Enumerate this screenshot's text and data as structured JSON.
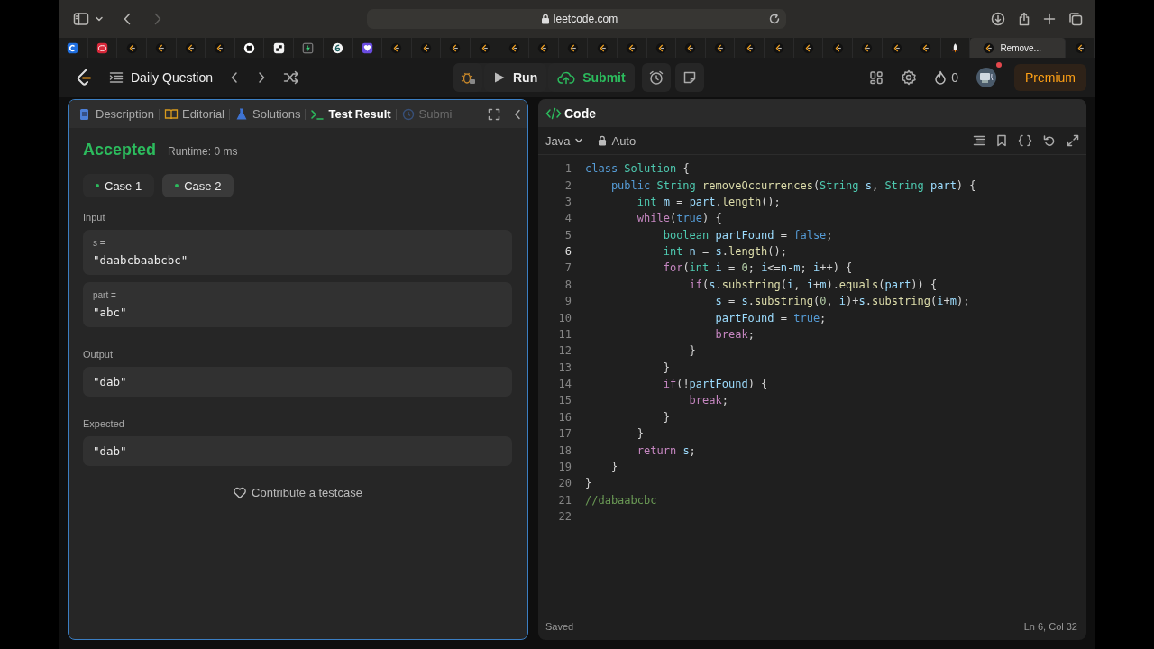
{
  "browser": {
    "url": "leetcode.com",
    "tabs": [
      {
        "kind": "c",
        "selected": false
      },
      {
        "kind": "fup",
        "selected": false
      },
      {
        "kind": "lc",
        "selected": false
      },
      {
        "kind": "lc",
        "selected": false
      },
      {
        "kind": "lc",
        "selected": false
      },
      {
        "kind": "lc",
        "selected": false
      },
      {
        "kind": "github",
        "selected": false
      },
      {
        "kind": "square",
        "selected": false
      },
      {
        "kind": "bolt",
        "selected": false
      },
      {
        "kind": "six",
        "selected": false
      },
      {
        "kind": "heart",
        "selected": false
      },
      {
        "kind": "lc",
        "selected": false
      },
      {
        "kind": "lc",
        "selected": false
      },
      {
        "kind": "lc",
        "selected": false
      },
      {
        "kind": "lc",
        "selected": false
      },
      {
        "kind": "lc",
        "selected": false
      },
      {
        "kind": "lc",
        "selected": false
      },
      {
        "kind": "lc",
        "selected": false
      },
      {
        "kind": "lc",
        "selected": false
      },
      {
        "kind": "lc",
        "selected": false
      },
      {
        "kind": "lc",
        "selected": false
      },
      {
        "kind": "lc",
        "selected": false
      },
      {
        "kind": "lc",
        "selected": false
      },
      {
        "kind": "lc",
        "selected": false
      },
      {
        "kind": "lc",
        "selected": false
      },
      {
        "kind": "lc",
        "selected": false
      },
      {
        "kind": "lc",
        "selected": false
      },
      {
        "kind": "lc",
        "selected": false
      },
      {
        "kind": "lc",
        "selected": false
      },
      {
        "kind": "lc",
        "selected": false
      },
      {
        "kind": "rocket",
        "selected": false
      },
      {
        "kind": "lc",
        "label": "Remove...",
        "selected": true
      },
      {
        "kind": "lc",
        "selected": false
      }
    ]
  },
  "navbar": {
    "title": "Daily Question",
    "run": "Run",
    "submit": "Submit",
    "streak": "0",
    "premium": "Premium"
  },
  "left_panel": {
    "tabs": [
      {
        "kind": "description",
        "label": "Description",
        "selected": false
      },
      {
        "kind": "editorial",
        "label": "Editorial",
        "selected": false
      },
      {
        "kind": "solutions",
        "label": "Solutions",
        "selected": false
      },
      {
        "kind": "test",
        "label": "Test Result",
        "selected": true
      },
      {
        "kind": "submissions",
        "label": "Submi",
        "selected": false
      }
    ],
    "status": "Accepted",
    "runtime": "Runtime: 0 ms",
    "cases": [
      {
        "label": "Case 1",
        "selected": false
      },
      {
        "label": "Case 2",
        "selected": true
      }
    ],
    "input_label": "Input",
    "inputs": [
      {
        "name": "s =",
        "value": "\"daabcbaabcbc\""
      },
      {
        "name": "part =",
        "value": "\"abc\""
      }
    ],
    "output_label": "Output",
    "output": "\"dab\"",
    "expected_label": "Expected",
    "expected": "\"dab\"",
    "contribute": "Contribute a testcase"
  },
  "code_panel": {
    "title": "Code",
    "language": "Java",
    "mode": "Auto",
    "lines": [
      {
        "number": "1",
        "current": false,
        "tokens": [
          {
            "kind": "keyword",
            "text": "class"
          },
          {
            "kind": "type",
            "text": " Solution"
          },
          {
            "kind": "plain",
            "text": " {"
          }
        ]
      },
      {
        "number": "2",
        "current": false,
        "tokens": [
          {
            "kind": "keyword",
            "text": "    public"
          },
          {
            "kind": "type",
            "text": " String"
          },
          {
            "kind": "function",
            "text": " removeOccurrences"
          },
          {
            "kind": "plain",
            "text": "("
          },
          {
            "kind": "type",
            "text": "String"
          },
          {
            "kind": "variable",
            "text": " s"
          },
          {
            "kind": "plain",
            "text": ", "
          },
          {
            "kind": "type",
            "text": "String"
          },
          {
            "kind": "variable",
            "text": " part"
          },
          {
            "kind": "plain",
            "text": ") {"
          }
        ]
      },
      {
        "number": "3",
        "current": false,
        "tokens": [
          {
            "kind": "type",
            "text": "        int"
          },
          {
            "kind": "variable",
            "text": " m"
          },
          {
            "kind": "plain",
            "text": " = "
          },
          {
            "kind": "variable",
            "text": "part"
          },
          {
            "kind": "plain",
            "text": "."
          },
          {
            "kind": "function",
            "text": "length"
          },
          {
            "kind": "plain",
            "text": "();"
          }
        ]
      },
      {
        "number": "4",
        "current": false,
        "tokens": [
          {
            "kind": "control",
            "text": "        while"
          },
          {
            "kind": "plain",
            "text": "("
          },
          {
            "kind": "keyword",
            "text": "true"
          },
          {
            "kind": "plain",
            "text": ") {"
          }
        ]
      },
      {
        "number": "5",
        "current": false,
        "tokens": [
          {
            "kind": "type",
            "text": "            boolean"
          },
          {
            "kind": "variable",
            "text": " partFound"
          },
          {
            "kind": "plain",
            "text": " = "
          },
          {
            "kind": "keyword",
            "text": "false"
          },
          {
            "kind": "plain",
            "text": ";"
          }
        ]
      },
      {
        "number": "6",
        "current": true,
        "tokens": [
          {
            "kind": "type",
            "text": "            int"
          },
          {
            "kind": "variable",
            "text": " n"
          },
          {
            "kind": "plain",
            "text": " = "
          },
          {
            "kind": "variable",
            "text": "s"
          },
          {
            "kind": "plain",
            "text": "."
          },
          {
            "kind": "function",
            "text": "length"
          },
          {
            "kind": "plain",
            "text": "();"
          }
        ]
      },
      {
        "number": "7",
        "current": false,
        "tokens": [
          {
            "kind": "control",
            "text": "            for"
          },
          {
            "kind": "plain",
            "text": "("
          },
          {
            "kind": "type",
            "text": "int"
          },
          {
            "kind": "variable",
            "text": " i"
          },
          {
            "kind": "plain",
            "text": " = "
          },
          {
            "kind": "number",
            "text": "0"
          },
          {
            "kind": "plain",
            "text": "; "
          },
          {
            "kind": "variable",
            "text": "i"
          },
          {
            "kind": "plain",
            "text": "<="
          },
          {
            "kind": "variable",
            "text": "n"
          },
          {
            "kind": "plain",
            "text": "-"
          },
          {
            "kind": "variable",
            "text": "m"
          },
          {
            "kind": "plain",
            "text": "; "
          },
          {
            "kind": "variable",
            "text": "i"
          },
          {
            "kind": "plain",
            "text": "++) {"
          }
        ]
      },
      {
        "number": "8",
        "current": false,
        "tokens": [
          {
            "kind": "control",
            "text": "                if"
          },
          {
            "kind": "plain",
            "text": "("
          },
          {
            "kind": "variable",
            "text": "s"
          },
          {
            "kind": "plain",
            "text": "."
          },
          {
            "kind": "function",
            "text": "substring"
          },
          {
            "kind": "plain",
            "text": "("
          },
          {
            "kind": "variable",
            "text": "i"
          },
          {
            "kind": "plain",
            "text": ", "
          },
          {
            "kind": "variable",
            "text": "i"
          },
          {
            "kind": "plain",
            "text": "+"
          },
          {
            "kind": "variable",
            "text": "m"
          },
          {
            "kind": "plain",
            "text": ")."
          },
          {
            "kind": "function",
            "text": "equals"
          },
          {
            "kind": "plain",
            "text": "("
          },
          {
            "kind": "variable",
            "text": "part"
          },
          {
            "kind": "plain",
            "text": ")) {"
          }
        ]
      },
      {
        "number": "9",
        "current": false,
        "tokens": [
          {
            "kind": "variable",
            "text": "                    s"
          },
          {
            "kind": "plain",
            "text": " = "
          },
          {
            "kind": "variable",
            "text": "s"
          },
          {
            "kind": "plain",
            "text": "."
          },
          {
            "kind": "function",
            "text": "substring"
          },
          {
            "kind": "plain",
            "text": "("
          },
          {
            "kind": "number",
            "text": "0"
          },
          {
            "kind": "plain",
            "text": ", "
          },
          {
            "kind": "variable",
            "text": "i"
          },
          {
            "kind": "plain",
            "text": ")+"
          },
          {
            "kind": "variable",
            "text": "s"
          },
          {
            "kind": "plain",
            "text": "."
          },
          {
            "kind": "function",
            "text": "substring"
          },
          {
            "kind": "plain",
            "text": "("
          },
          {
            "kind": "variable",
            "text": "i"
          },
          {
            "kind": "plain",
            "text": "+"
          },
          {
            "kind": "variable",
            "text": "m"
          },
          {
            "kind": "plain",
            "text": ");"
          }
        ]
      },
      {
        "number": "10",
        "current": false,
        "tokens": [
          {
            "kind": "variable",
            "text": "                    partFound"
          },
          {
            "kind": "plain",
            "text": " = "
          },
          {
            "kind": "keyword",
            "text": "true"
          },
          {
            "kind": "plain",
            "text": ";"
          }
        ]
      },
      {
        "number": "11",
        "current": false,
        "tokens": [
          {
            "kind": "control",
            "text": "                    break"
          },
          {
            "kind": "plain",
            "text": ";"
          }
        ]
      },
      {
        "number": "12",
        "current": false,
        "tokens": [
          {
            "kind": "plain",
            "text": "                }"
          }
        ]
      },
      {
        "number": "13",
        "current": false,
        "tokens": [
          {
            "kind": "plain",
            "text": "            }"
          }
        ]
      },
      {
        "number": "14",
        "current": false,
        "tokens": [
          {
            "kind": "control",
            "text": "            if"
          },
          {
            "kind": "plain",
            "text": "(!"
          },
          {
            "kind": "variable",
            "text": "partFound"
          },
          {
            "kind": "plain",
            "text": ") {"
          }
        ]
      },
      {
        "number": "15",
        "current": false,
        "tokens": [
          {
            "kind": "control",
            "text": "                break"
          },
          {
            "kind": "plain",
            "text": ";"
          }
        ]
      },
      {
        "number": "16",
        "current": false,
        "tokens": [
          {
            "kind": "plain",
            "text": "            }"
          }
        ]
      },
      {
        "number": "17",
        "current": false,
        "tokens": [
          {
            "kind": "plain",
            "text": "        }"
          }
        ]
      },
      {
        "number": "18",
        "current": false,
        "tokens": [
          {
            "kind": "control",
            "text": "        return"
          },
          {
            "kind": "variable",
            "text": " s"
          },
          {
            "kind": "plain",
            "text": ";"
          }
        ]
      },
      {
        "number": "19",
        "current": false,
        "tokens": [
          {
            "kind": "plain",
            "text": "    }"
          }
        ]
      },
      {
        "number": "20",
        "current": false,
        "tokens": [
          {
            "kind": "plain",
            "text": "}"
          }
        ]
      },
      {
        "number": "21",
        "current": false,
        "tokens": [
          {
            "kind": "comment",
            "text": "//dabaabcbc"
          }
        ]
      },
      {
        "number": "22",
        "current": false
      }
    ],
    "status": "Saved",
    "cursor": "Ln 6, Col 32"
  }
}
